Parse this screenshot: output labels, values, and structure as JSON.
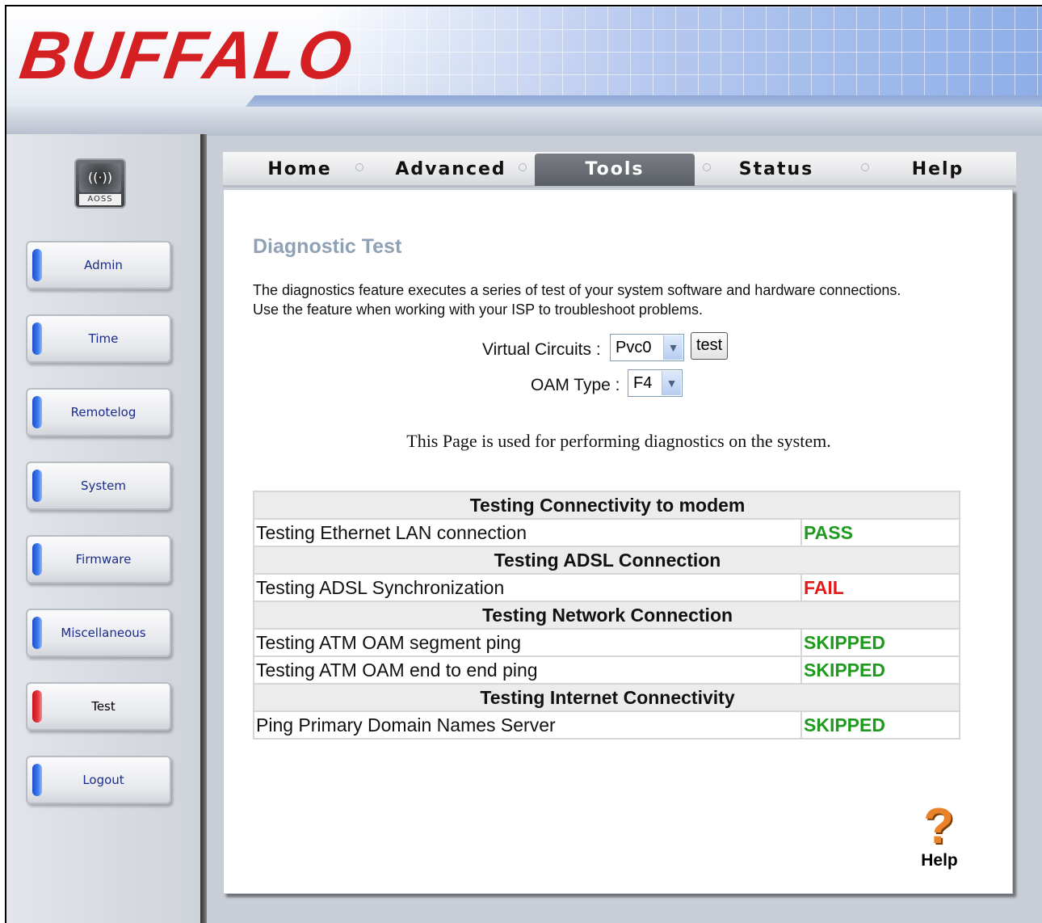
{
  "brand": {
    "logo_text": "BUFFALO",
    "accent": "#d42023"
  },
  "sidebar": {
    "aoss": {
      "icon": "aoss-icon",
      "label": "AOSS"
    },
    "items": [
      {
        "label": "Admin"
      },
      {
        "label": "Time"
      },
      {
        "label": "Remotelog"
      },
      {
        "label": "System"
      },
      {
        "label": "Firmware"
      },
      {
        "label": "Miscellaneous"
      },
      {
        "label": "Test",
        "active": true
      },
      {
        "label": "Logout"
      }
    ]
  },
  "tabs": [
    {
      "label": "Home"
    },
    {
      "label": "Advanced"
    },
    {
      "label": "Tools",
      "active": true
    },
    {
      "label": "Status"
    },
    {
      "label": "Help"
    }
  ],
  "main": {
    "title": "Diagnostic Test",
    "description": "The diagnostics feature executes a series of test of your system software and hardware connections. Use the feature when working with your ISP to troubleshoot problems.",
    "virtual_circuits_label": "Virtual Circuits :",
    "virtual_circuits_value": "Pvc0",
    "test_button": "test",
    "oam_type_label": "OAM Type :",
    "oam_type_value": "F4",
    "note": "This Page is used for performing diagnostics on the system."
  },
  "results": {
    "sections": [
      {
        "heading": "Testing Connectivity to modem",
        "rows": [
          {
            "label": "Testing Ethernet LAN connection",
            "status": "PASS"
          }
        ]
      },
      {
        "heading": "Testing ADSL Connection",
        "rows": [
          {
            "label": "Testing ADSL Synchronization",
            "status": "FAIL"
          }
        ]
      },
      {
        "heading": "Testing Network Connection",
        "rows": [
          {
            "label": "Testing ATM OAM segment ping",
            "status": "SKIPPED"
          },
          {
            "label": "Testing ATM OAM end to end ping",
            "status": "SKIPPED"
          }
        ]
      },
      {
        "heading": "Testing Internet Connectivity",
        "rows": [
          {
            "label": "Ping Primary Domain Names Server",
            "status": "SKIPPED"
          }
        ]
      }
    ],
    "colors": {
      "pass": "#1f9a1f",
      "fail": "#e01b1b",
      "skipped": "#1f9a1f"
    }
  },
  "help": {
    "label": "Help",
    "icon": "question-icon"
  }
}
